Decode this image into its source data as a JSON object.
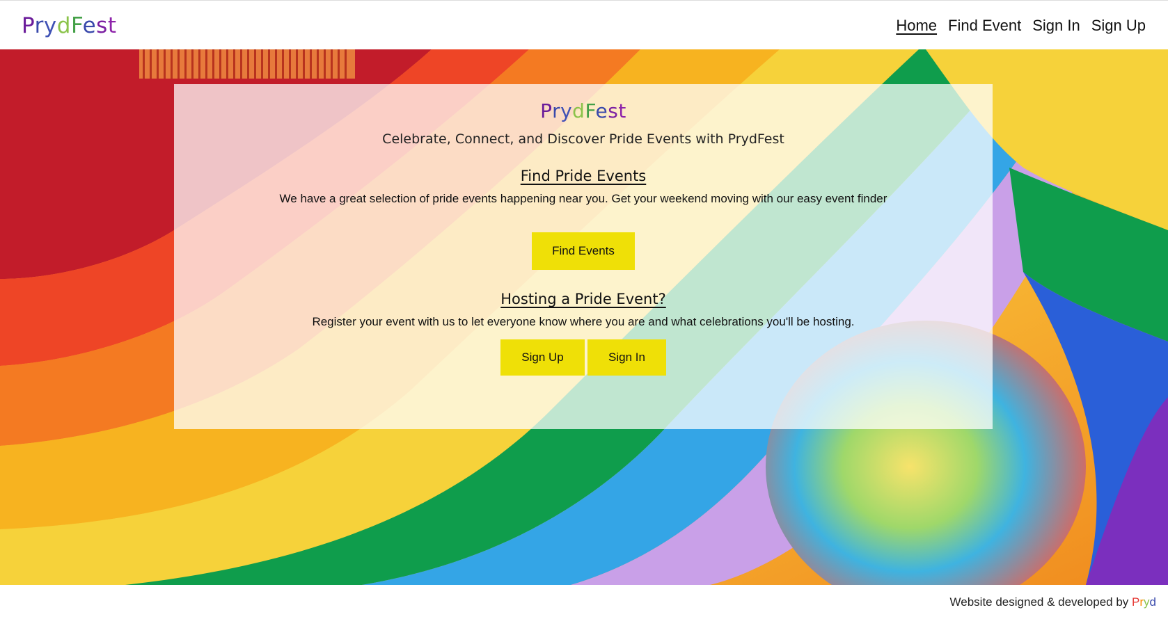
{
  "brand": {
    "letters": [
      {
        "ch": "P",
        "color": "#6a1b9a"
      },
      {
        "ch": "r",
        "color": "#3949ab"
      },
      {
        "ch": "y",
        "color": "#3f51b5"
      },
      {
        "ch": "d",
        "color": "#8bc34a"
      },
      {
        "ch": "F",
        "color": "#43a047"
      },
      {
        "ch": "e",
        "color": "#3949ab"
      },
      {
        "ch": "s",
        "color": "#7b1fa2"
      },
      {
        "ch": "t",
        "color": "#8e24aa"
      }
    ]
  },
  "nav": {
    "items": [
      {
        "label": "Home",
        "active": true
      },
      {
        "label": "Find Event",
        "active": false
      },
      {
        "label": "Sign In",
        "active": false
      },
      {
        "label": "Sign Up",
        "active": false
      }
    ]
  },
  "card": {
    "title_letters": [
      {
        "ch": "P",
        "color": "#6a1b9a"
      },
      {
        "ch": "r",
        "color": "#3949ab"
      },
      {
        "ch": "y",
        "color": "#3f51b5"
      },
      {
        "ch": "d",
        "color": "#8bc34a"
      },
      {
        "ch": "F",
        "color": "#43a047"
      },
      {
        "ch": "e",
        "color": "#3949ab"
      },
      {
        "ch": "s",
        "color": "#7b1fa2"
      },
      {
        "ch": "t",
        "color": "#8e24aa"
      }
    ],
    "tagline": "Celebrate, Connect, and Discover Pride Events with PrydFest",
    "find": {
      "heading": "Find Pride Events",
      "text": "We have a great selection of pride events happening near you. Get your weekend moving with our easy event finder",
      "button": "Find Events"
    },
    "host": {
      "heading": "Hosting a Pride Event?",
      "text": "Register your event with us to let everyone know where you are and what celebrations you'll be hosting.",
      "signup_button": "Sign Up",
      "signin_button": "Sign In"
    }
  },
  "footer": {
    "text": "Website designed & developed by ",
    "brand_letters": [
      {
        "ch": "P",
        "color": "#e53935"
      },
      {
        "ch": "r",
        "color": "#fb8c00"
      },
      {
        "ch": "y",
        "color": "#8bc34a"
      },
      {
        "ch": "d",
        "color": "#3949ab"
      }
    ]
  },
  "colors": {
    "button": "#efe007",
    "card_overlay": "rgba(255,255,255,0.74)"
  }
}
